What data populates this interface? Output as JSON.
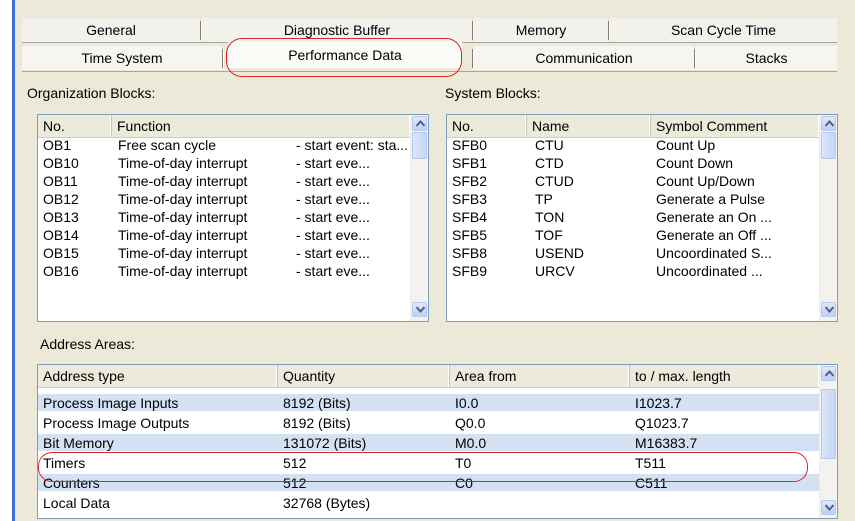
{
  "tabs": {
    "row1": [
      {
        "label": "General"
      },
      {
        "label": "Diagnostic Buffer"
      },
      {
        "label": "Memory"
      },
      {
        "label": "Scan Cycle Time"
      }
    ],
    "row2": [
      {
        "label": "Time System"
      },
      {
        "label": "Performance Data",
        "active": true
      },
      {
        "label": "Communication"
      },
      {
        "label": "Stacks"
      }
    ]
  },
  "ob_section": {
    "label": "Organization Blocks:",
    "columns": [
      "No.",
      "Function"
    ],
    "rows": [
      {
        "no": "OB1",
        "function": "Free scan cycle",
        "extra": "- start event: sta..."
      },
      {
        "no": "OB10",
        "function": "Time-of-day interrupt",
        "extra": "- start eve..."
      },
      {
        "no": "OB11",
        "function": "Time-of-day interrupt",
        "extra": "- start eve..."
      },
      {
        "no": "OB12",
        "function": "Time-of-day interrupt",
        "extra": "- start eve..."
      },
      {
        "no": "OB13",
        "function": "Time-of-day interrupt",
        "extra": "- start eve..."
      },
      {
        "no": "OB14",
        "function": "Time-of-day interrupt",
        "extra": "- start eve..."
      },
      {
        "no": "OB15",
        "function": "Time-of-day interrupt",
        "extra": "- start eve..."
      },
      {
        "no": "OB16",
        "function": "Time-of-day interrupt",
        "extra": "- start eve..."
      }
    ]
  },
  "sb_section": {
    "label": "System Blocks:",
    "columns": [
      "No.",
      "Name",
      "Symbol Comment"
    ],
    "rows": [
      {
        "no": "SFB0",
        "name": "CTU",
        "comment": "Count Up"
      },
      {
        "no": "SFB1",
        "name": "CTD",
        "comment": "Count Down"
      },
      {
        "no": "SFB2",
        "name": "CTUD",
        "comment": "Count Up/Down"
      },
      {
        "no": "SFB3",
        "name": "TP",
        "comment": "Generate a Pulse"
      },
      {
        "no": "SFB4",
        "name": "TON",
        "comment": "Generate an On ..."
      },
      {
        "no": "SFB5",
        "name": "TOF",
        "comment": "Generate an Off ..."
      },
      {
        "no": "SFB8",
        "name": "USEND",
        "comment": "Uncoordinated S..."
      },
      {
        "no": "SFB9",
        "name": "URCV",
        "comment": "Uncoordinated ..."
      }
    ]
  },
  "addr_section": {
    "label": "Address Areas:",
    "columns": [
      "Address type",
      "Quantity",
      "Area from",
      "to / max. length"
    ],
    "rows": [
      {
        "type": "Process Image Inputs",
        "quantity": "8192 (Bits)",
        "from": "I0.0",
        "to": "I1023.7",
        "band": true
      },
      {
        "type": "Process Image Outputs",
        "quantity": "8192 (Bits)",
        "from": "Q0.0",
        "to": "Q1023.7",
        "band": false
      },
      {
        "type": "Bit Memory",
        "quantity": "131072 (Bits)",
        "from": "M0.0",
        "to": "M16383.7",
        "band": true
      },
      {
        "type": "Timers",
        "quantity": "512",
        "from": "T0",
        "to": "T511",
        "band": false
      },
      {
        "type": "Counters",
        "quantity": "512",
        "from": "C0",
        "to": "C511",
        "band": true
      },
      {
        "type": "Local Data",
        "quantity": "32768 (Bytes)",
        "from": "",
        "to": "",
        "band": false
      }
    ]
  },
  "colors": {
    "highlight_oval": "#d8262a",
    "row_band": "#d4e1f2",
    "dialog_bg": "#ece9d8"
  }
}
